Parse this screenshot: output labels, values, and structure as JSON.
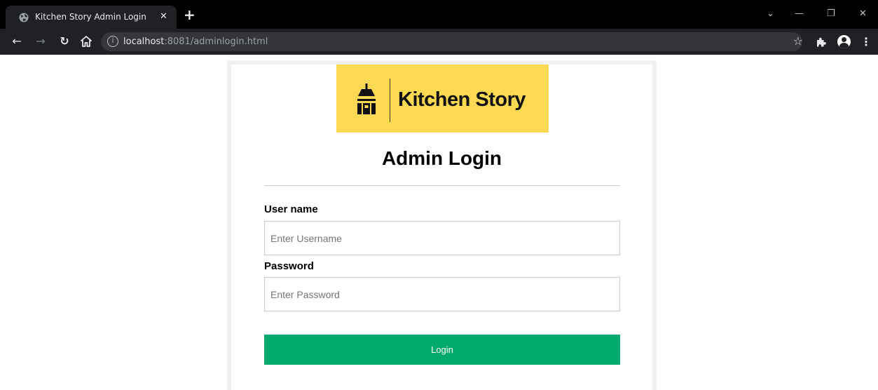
{
  "browser": {
    "tab_title": "Kitchen Story Admin Login",
    "tab_close": "✕",
    "new_tab": "+",
    "url_host": "localhost",
    "url_rest": ":8081/adminlogin.html",
    "window_controls": {
      "minimize": "—",
      "restore": "❐",
      "close": "✕",
      "tab_search": "⌄"
    }
  },
  "logo": {
    "brand_name": "Kitchen Story",
    "background": "#fcd953"
  },
  "login_form": {
    "heading": "Admin Login",
    "username_label": "User name",
    "username_placeholder": "Enter Username",
    "password_label": "Password",
    "password_placeholder": "Enter Password",
    "submit_label": "Login",
    "accent": "#04aa6d"
  },
  "icons": {
    "back": "back-arrow-icon",
    "forward": "forward-arrow-icon",
    "reload": "reload-icon",
    "home": "home-icon",
    "info": "site-info-icon",
    "bookmark": "star-icon",
    "extensions": "puzzle-icon",
    "profile": "avatar-icon",
    "menu": "kebab-menu-icon"
  }
}
